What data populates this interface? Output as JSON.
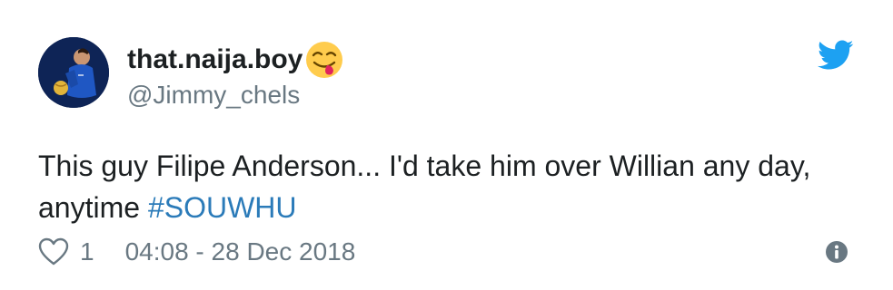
{
  "author": {
    "display_name": "that.naija.boy",
    "handle": "@Jimmy_chels",
    "avatar_icon": "avatar-photo",
    "name_emoji": "face-savoring-food-emoji"
  },
  "tweet": {
    "text": "This guy Filipe Anderson... I'd take him over Willian any day, anytime ",
    "hashtag": "#SOUWHU"
  },
  "footer": {
    "like_icon": "heart-icon",
    "like_count": "1",
    "timestamp": "04:08 - 28 Dec 2018",
    "info_icon": "info-icon"
  },
  "brand": {
    "icon": "twitter-bird-icon",
    "color": "#1da1f2"
  },
  "colors": {
    "text": "#1c2022",
    "secondary": "#697882",
    "link": "#2b7bb9"
  }
}
